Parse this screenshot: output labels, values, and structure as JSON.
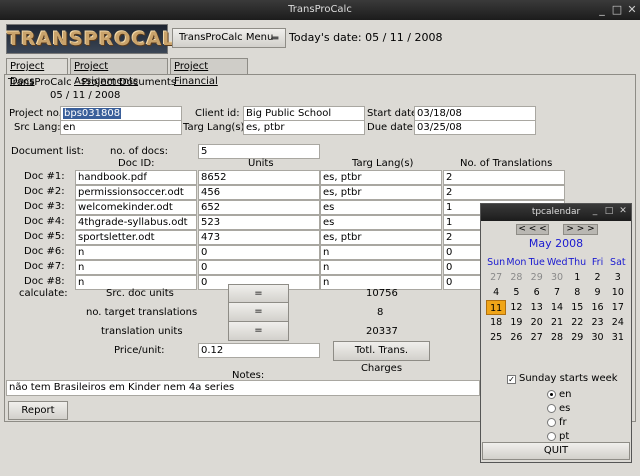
{
  "window": {
    "title": "TransProCalc"
  },
  "header": {
    "logo_text": "TRANSPROCALC",
    "menu_label": "TransProCalc Menu",
    "date_label": "Today's date: 05 / 11 / 2008"
  },
  "tabs": [
    "Project Docs",
    "Project Assignments",
    "Project Financial"
  ],
  "page": {
    "title": "TransProCalc - Project Documents",
    "date": "05 / 11 / 2008"
  },
  "form": {
    "project_no_label": "Project no.:",
    "project_no": "bps031808",
    "client_id_label": "Client id:",
    "client_id": "Big Public School",
    "start_date_label": "Start date:",
    "start_date": "03/18/08",
    "src_lang_label": "Src Lang:",
    "src_lang": "en",
    "targ_langs_label": "Targ Lang(s):",
    "targ_langs": "es, ptbr",
    "due_date_label": "Due date:",
    "due_date": "03/25/08"
  },
  "doc_list": {
    "label": "Document list:",
    "num_docs_label": "no. of docs:",
    "num_docs": "5",
    "headers": [
      "Doc ID:",
      "Units",
      "Targ Lang(s)",
      "No. of Translations"
    ],
    "rows": [
      {
        "label": "Doc #1:",
        "id": "handbook.pdf",
        "units": "8652",
        "langs": "es, ptbr",
        "count": "2"
      },
      {
        "label": "Doc #2:",
        "id": "permissionsoccer.odt",
        "units": "456",
        "langs": "es, ptbr",
        "count": "2"
      },
      {
        "label": "Doc #3:",
        "id": "welcomekinder.odt",
        "units": "652",
        "langs": "es",
        "count": "1"
      },
      {
        "label": "Doc #4:",
        "id": "4thgrade-syllabus.odt",
        "units": "523",
        "langs": "es",
        "count": "1"
      },
      {
        "label": "Doc #5:",
        "id": "sportsletter.odt",
        "units": "473",
        "langs": "es, ptbr",
        "count": "2"
      },
      {
        "label": "Doc #6:",
        "id": "n",
        "units": "0",
        "langs": "n",
        "count": "0"
      },
      {
        "label": "Doc #7:",
        "id": "n",
        "units": "0",
        "langs": "n",
        "count": "0"
      },
      {
        "label": "Doc #8:",
        "id": "n",
        "units": "0",
        "langs": "n",
        "count": "0"
      }
    ]
  },
  "calc": {
    "label": "calculate:",
    "src_units_label": "Src. doc units",
    "src_units": "10756",
    "target_trans_label": "no. target translations",
    "target_trans": "8",
    "trans_units_label": "translation units",
    "trans_units": "20337",
    "equals": "=",
    "price_label": "Price/unit:",
    "price": "0.12",
    "charges_button": "Totl. Trans. Charges"
  },
  "notes": {
    "label": "Notes:",
    "text": "não tem Brasileiros em Kinder nem 4a series"
  },
  "footer": {
    "report_button": "Report"
  },
  "calendar": {
    "title": "tpcalendar",
    "prev": "< < <",
    "next": "> > >",
    "month": "May 2008",
    "weekdays": [
      "Sun",
      "Mon",
      "Tue",
      "Wed",
      "Thu",
      "Fri",
      "Sat"
    ],
    "weeks": [
      [
        "27",
        "28",
        "29",
        "30",
        "1",
        "2",
        "3"
      ],
      [
        "4",
        "5",
        "6",
        "7",
        "8",
        "9",
        "10"
      ],
      [
        "11",
        "12",
        "13",
        "14",
        "15",
        "16",
        "17"
      ],
      [
        "18",
        "19",
        "20",
        "21",
        "22",
        "23",
        "24"
      ],
      [
        "25",
        "26",
        "27",
        "28",
        "29",
        "30",
        "31"
      ]
    ],
    "today": "11",
    "sunday_label": "Sunday starts week",
    "languages": [
      "en",
      "es",
      "fr",
      "pt"
    ],
    "selected_language": "en",
    "quit": "QUIT",
    "colors": {
      "month": "#1b1bd0",
      "weekday": "#1b1bd0",
      "today": "#f0a518"
    }
  }
}
